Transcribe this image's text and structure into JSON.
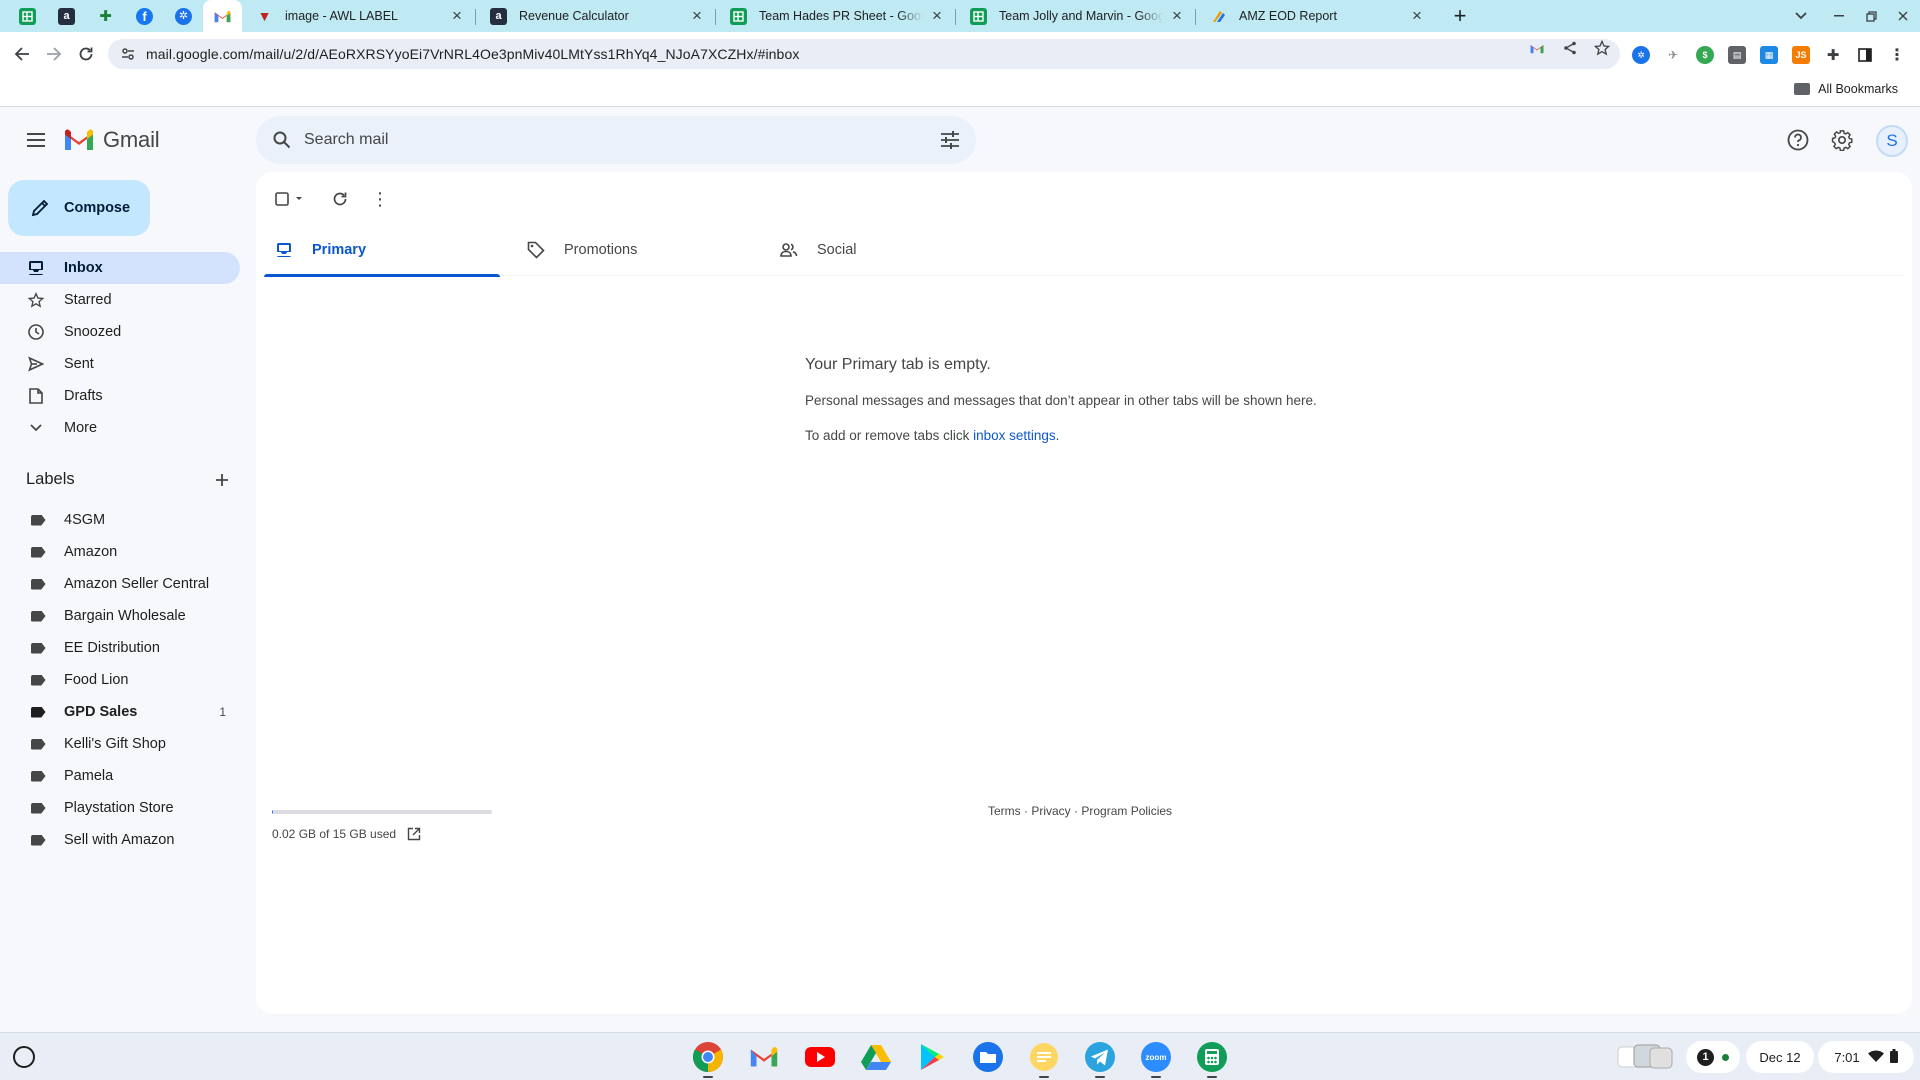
{
  "browser": {
    "pinned_tabs": [
      {
        "icon": "google-sheets-icon",
        "color": "#0f9d58"
      },
      {
        "icon": "amazon-icon",
        "color": "#232f3e"
      },
      {
        "icon": "puzzle-extension-icon",
        "color": "#188038"
      },
      {
        "icon": "facebook-icon",
        "color": "#1877f2"
      },
      {
        "icon": "circle-app-icon",
        "color": "#1a73e8"
      },
      {
        "icon": "gmail-icon",
        "color": "#ea4335"
      }
    ],
    "tabs": [
      {
        "title": "image - AWL LABEL",
        "icon": "awl-icon",
        "color": "#c5221f"
      },
      {
        "title": "Revenue Calculator",
        "icon": "amazon-icon",
        "color": "#232f3e"
      },
      {
        "title": "Team Hades PR Sheet - Google",
        "icon": "google-sheets-icon",
        "color": "#0f9d58"
      },
      {
        "title": "Team Jolly and Marvin - Google",
        "icon": "google-sheets-icon",
        "color": "#0f9d58"
      },
      {
        "title": "AMZ EOD Report",
        "icon": "report-icon",
        "color": "#f29900"
      }
    ],
    "url": "mail.google.com/mail/u/2/d/AEoRXRSYyoEi7VrNRL4Oe3pnMiv40LMtYss1RhYq4_NJoA7XCZHx/#inbox",
    "all_bookmarks_label": "All Bookmarks"
  },
  "gmail": {
    "wordmark": "Gmail",
    "search_placeholder": "Search mail",
    "avatar_letter": "S",
    "compose_label": "Compose",
    "nav": [
      {
        "label": "Inbox",
        "icon": "inbox-icon"
      },
      {
        "label": "Starred",
        "icon": "star-icon"
      },
      {
        "label": "Snoozed",
        "icon": "clock-icon"
      },
      {
        "label": "Sent",
        "icon": "send-icon"
      },
      {
        "label": "Drafts",
        "icon": "draft-icon"
      },
      {
        "label": "More",
        "icon": "chevron-down-icon"
      }
    ],
    "labels_heading": "Labels",
    "labels": [
      {
        "name": "4SGM",
        "count": ""
      },
      {
        "name": "Amazon",
        "count": ""
      },
      {
        "name": "Amazon Seller Central",
        "count": ""
      },
      {
        "name": "Bargain Wholesale",
        "count": ""
      },
      {
        "name": "EE Distribution",
        "count": ""
      },
      {
        "name": "Food Lion",
        "count": ""
      },
      {
        "name": "GPD Sales",
        "count": "1"
      },
      {
        "name": "Kelli's Gift Shop",
        "count": ""
      },
      {
        "name": "Pamela",
        "count": ""
      },
      {
        "name": "Playstation Store",
        "count": ""
      },
      {
        "name": "Sell with Amazon",
        "count": ""
      }
    ],
    "category_tabs": [
      {
        "label": "Primary",
        "icon": "inbox-icon"
      },
      {
        "label": "Promotions",
        "icon": "tag-icon"
      },
      {
        "label": "Social",
        "icon": "people-icon"
      }
    ],
    "empty_state": {
      "title": "Your Primary tab is empty.",
      "text": "Personal messages and messages that don’t appear in other tabs will be shown here.",
      "settings_prefix": "To add or remove tabs click ",
      "settings_link": "inbox settings",
      "settings_suffix": "."
    },
    "storage": {
      "used_text": "0.02 GB of 15 GB used",
      "fraction": 0.0013
    },
    "footer": {
      "terms": "Terms",
      "privacy": "Privacy",
      "policies": "Program Policies",
      "separator": " · "
    },
    "accent_color": "#0b57d0"
  },
  "shelf": {
    "apps": [
      {
        "icon": "chrome-icon"
      },
      {
        "icon": "gmail-icon"
      },
      {
        "icon": "youtube-icon"
      },
      {
        "icon": "google-drive-icon"
      },
      {
        "icon": "play-store-icon"
      },
      {
        "icon": "files-icon"
      },
      {
        "icon": "notes-icon"
      },
      {
        "icon": "telegram-icon"
      },
      {
        "icon": "zoom-icon",
        "label": "zoom"
      },
      {
        "icon": "sheets-calculator-icon"
      }
    ],
    "notification_count": "1",
    "date": "Dec 12",
    "time": "7:01"
  }
}
